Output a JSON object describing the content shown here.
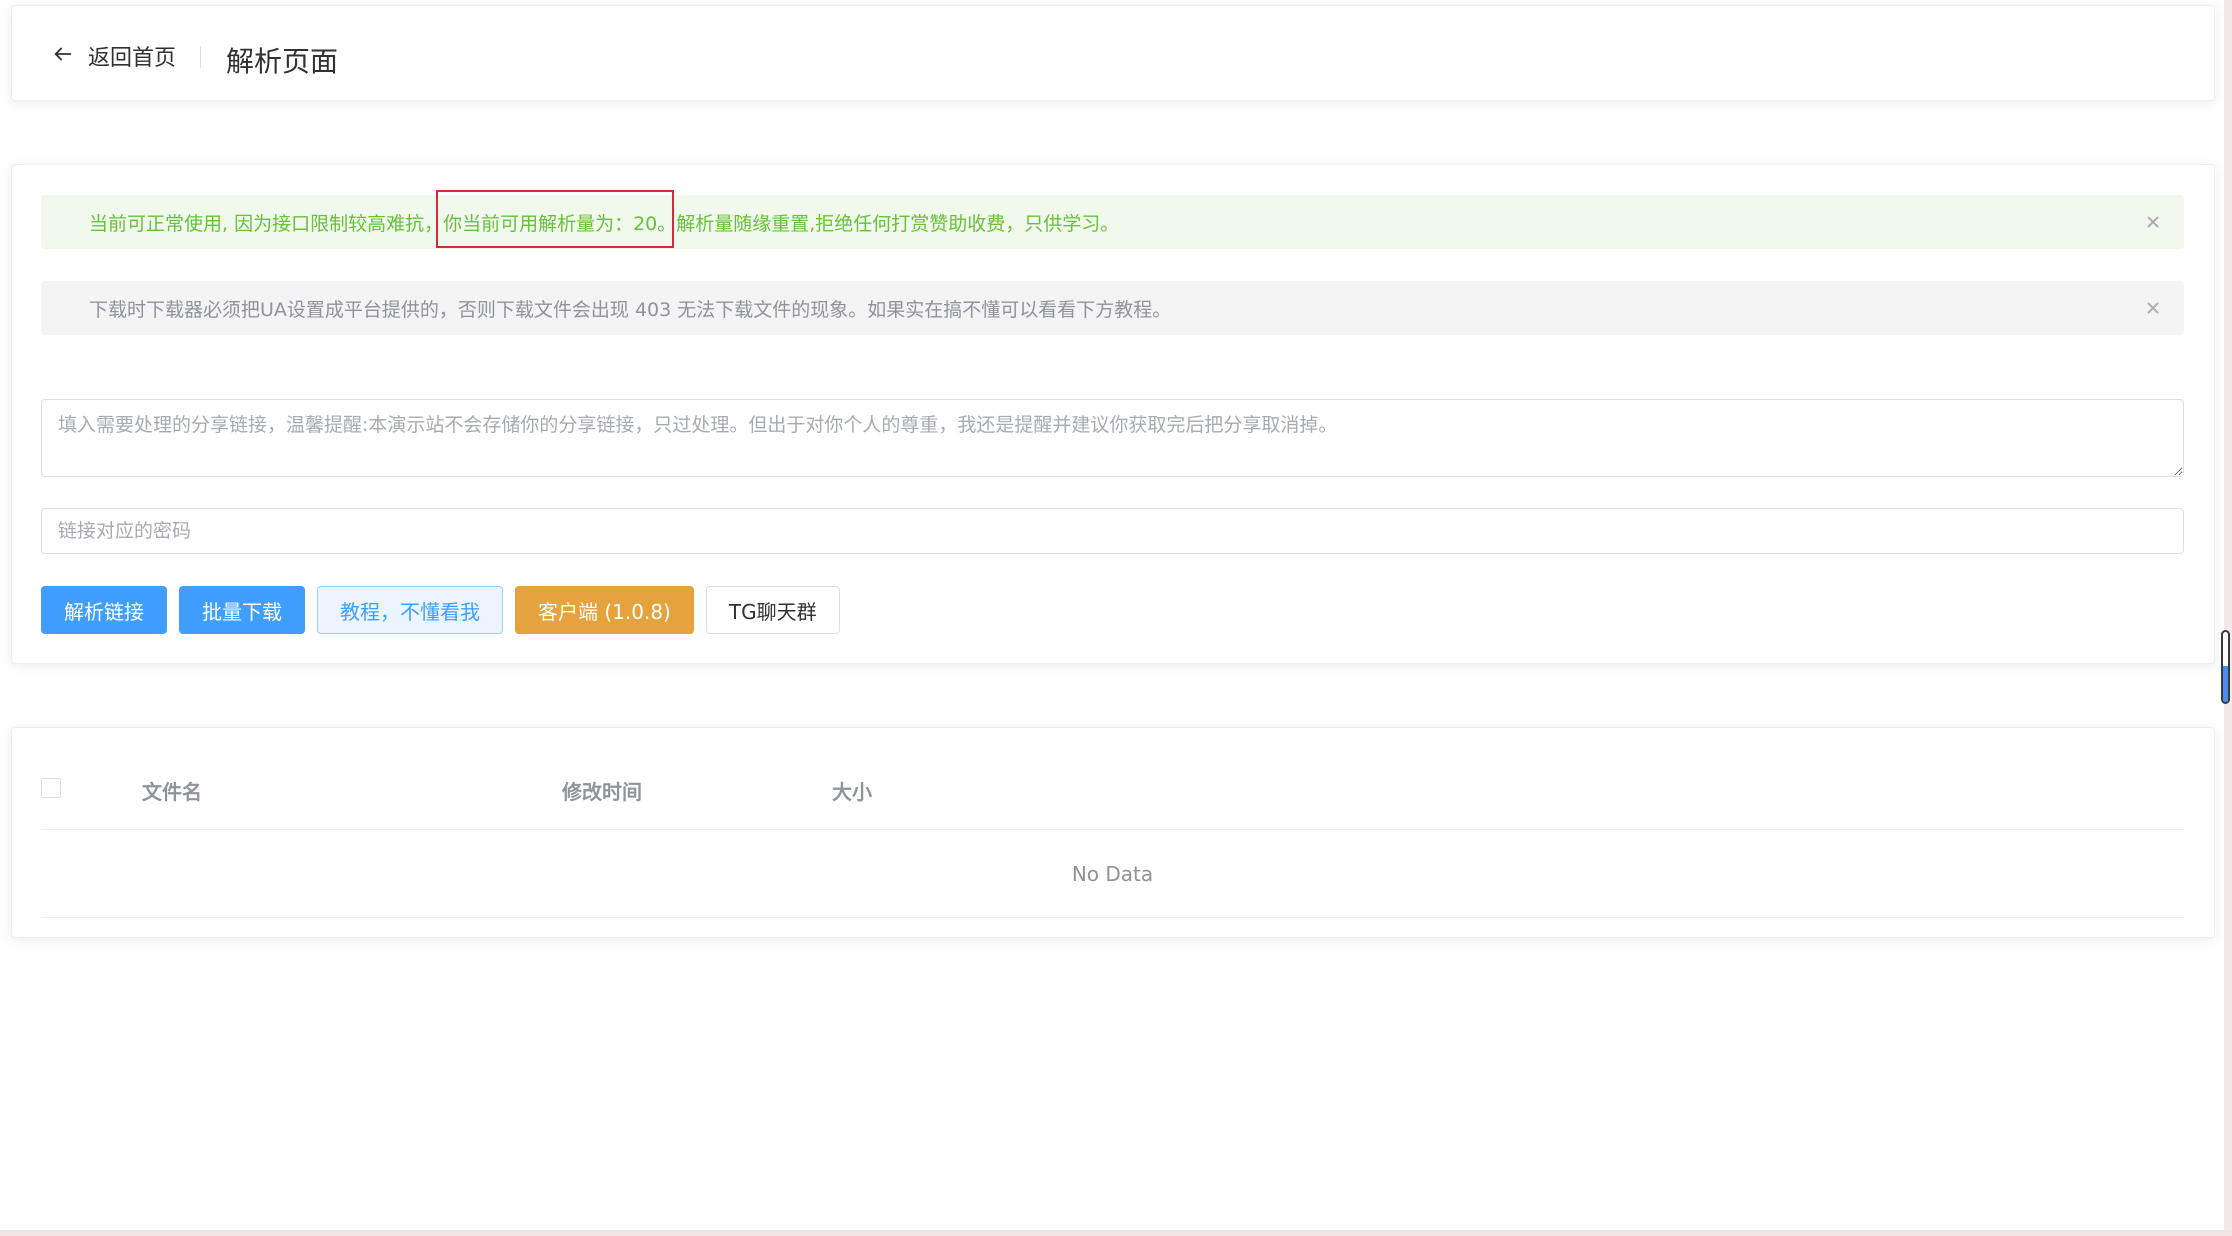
{
  "header": {
    "back_label": "返回首页",
    "title": "解析页面"
  },
  "alerts": {
    "success_text": "当前可正常使用, 因为接口限制较高难抗，你当前可用解析量为：20。解析量随缘重置,拒绝任何打赏赞助收费，只供学习。",
    "info_text": "下载时下载器必须把UA设置成平台提供的，否则下载文件会出现 403 无法下载文件的现象。如果实在搞不懂可以看看下方教程。"
  },
  "form": {
    "link_placeholder": "填入需要处理的分享链接，温馨提醒:本演示站不会存储你的分享链接，只过处理。但出于对你个人的尊重，我还是提醒并建议你获取完后把分享取消掉。",
    "link_value": "",
    "password_placeholder": "链接对应的密码",
    "password_value": ""
  },
  "buttons": {
    "parse": "解析链接",
    "batch_download": "批量下载",
    "tutorial": "教程，不懂看我",
    "client": "客户端 (1.0.8)",
    "tg_group": "TG聊天群"
  },
  "table": {
    "columns": [
      "文件名",
      "修改时间",
      "大小"
    ],
    "empty_text": "No Data"
  },
  "colors": {
    "primary": "#409eff",
    "warning": "#e6a23c",
    "success_text": "#67c23a",
    "info_text": "#909399",
    "highlight_border": "#c9303a"
  },
  "icons": {
    "back": "arrow-left-icon",
    "close": "close-icon"
  }
}
